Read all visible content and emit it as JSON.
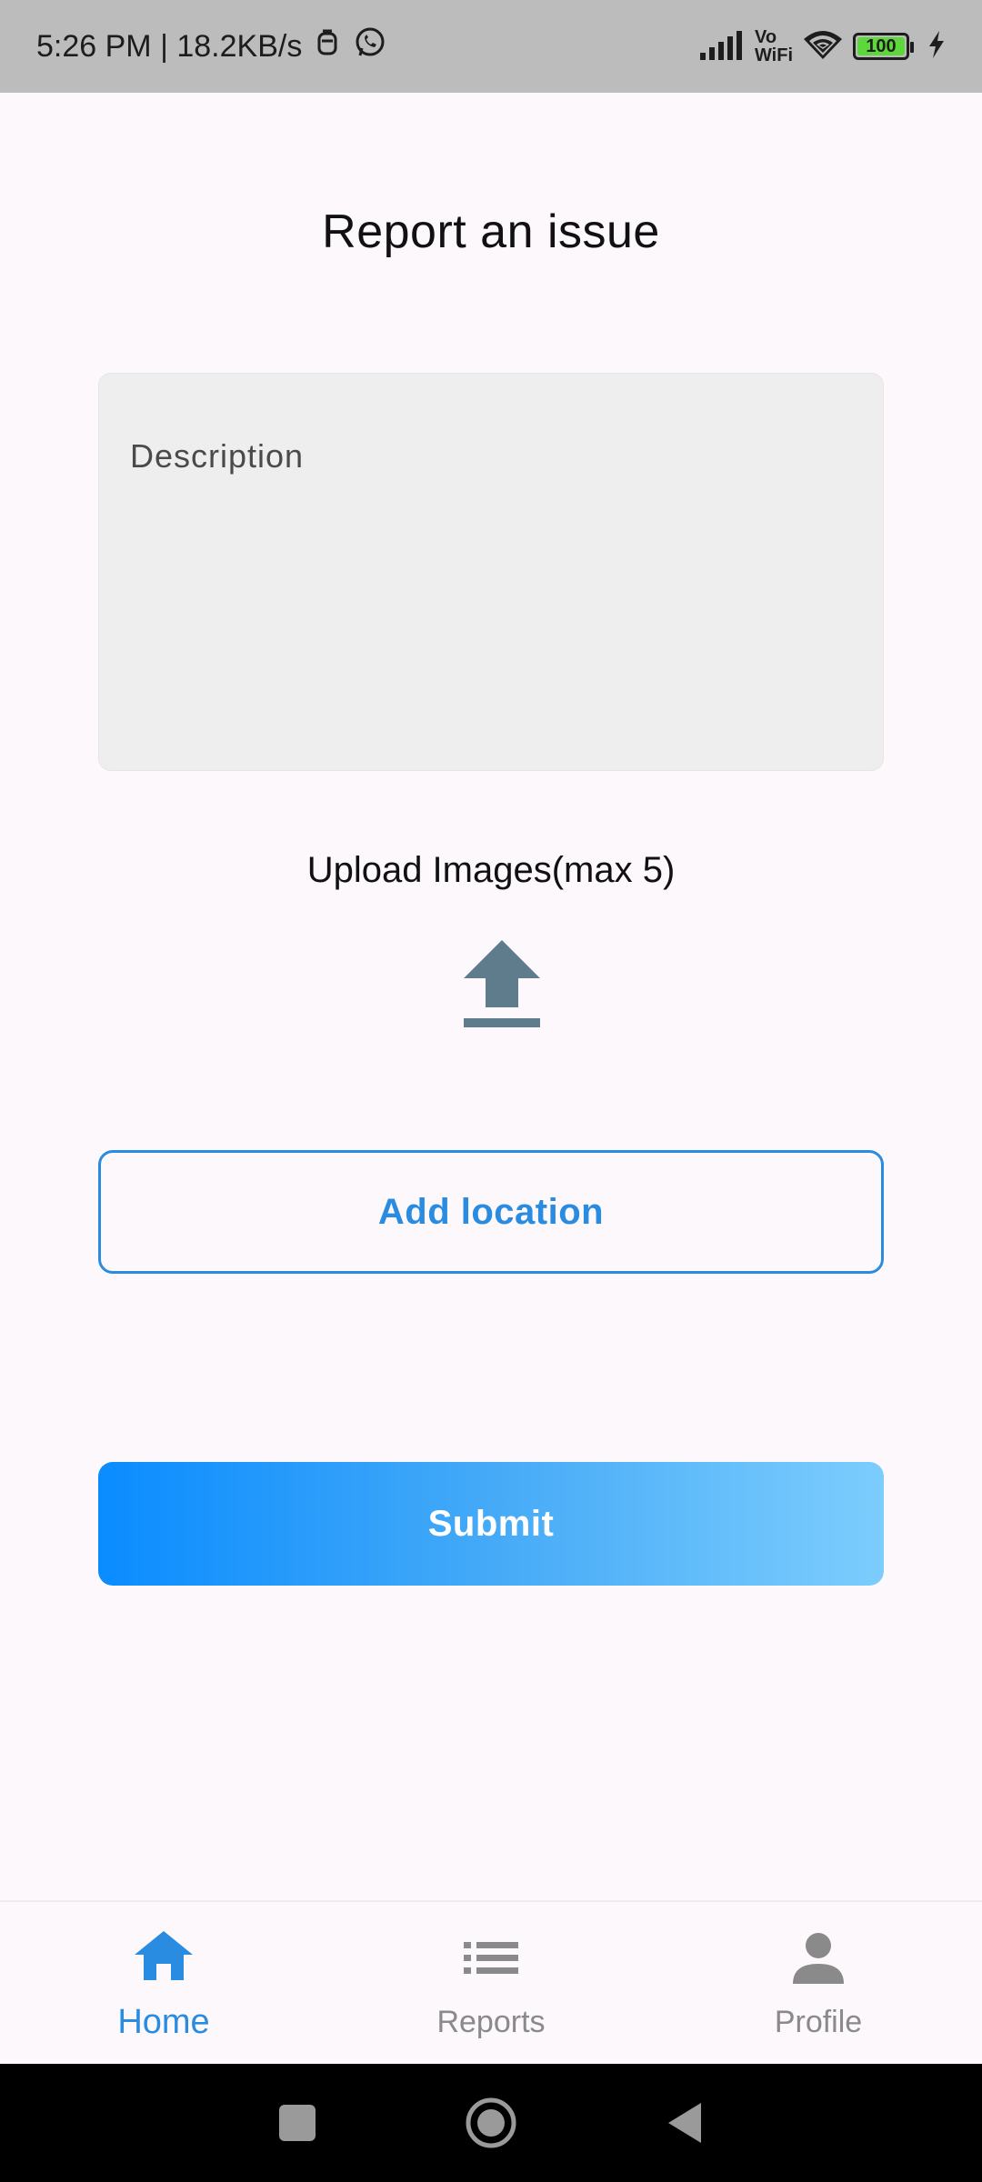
{
  "status_bar": {
    "time_speed": "5:26 PM | 18.2KB/s",
    "vowifi_top": "Vo",
    "vowifi_bottom": "WiFi",
    "battery": "100"
  },
  "page": {
    "title": "Report an issue"
  },
  "form": {
    "description_placeholder": "Description",
    "description_value": "",
    "upload_label": "Upload Images(max 5)",
    "add_location_label": "Add location",
    "submit_label": "Submit"
  },
  "bottom_nav": {
    "items": [
      {
        "label": "Home",
        "icon": "home-icon",
        "active": true
      },
      {
        "label": "Reports",
        "icon": "list-icon",
        "active": false
      },
      {
        "label": "Profile",
        "icon": "person-icon",
        "active": false
      }
    ]
  },
  "colors": {
    "accent": "#2a8ce0",
    "upload_icon": "#5f7c8c",
    "inactive": "#8a8a8a"
  }
}
